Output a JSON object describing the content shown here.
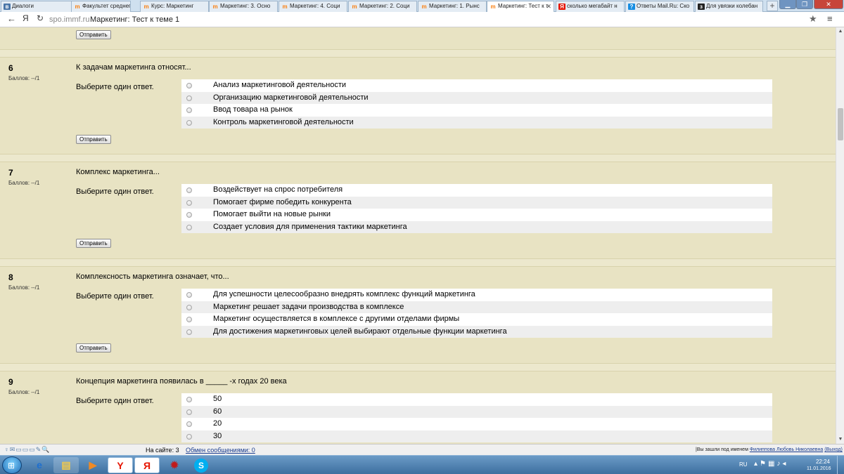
{
  "browser": {
    "tabs": [
      {
        "label": "Диалоги",
        "icon": "vk-icon",
        "color": "#4a76a8"
      },
      {
        "label": "Факультет среднег",
        "icon": "moodle-icon",
        "color": "#f98012"
      },
      {
        "label": "Курс: Маркетинг",
        "icon": "moodle-icon",
        "color": "#f98012"
      },
      {
        "label": "Маркетинг: 3. Осно",
        "icon": "moodle-icon",
        "color": "#f98012"
      },
      {
        "label": "Маркетинг: 4. Соци",
        "icon": "moodle-icon",
        "color": "#f98012"
      },
      {
        "label": "Маркетинг: 2. Соци",
        "icon": "moodle-icon",
        "color": "#f98012"
      },
      {
        "label": "Маркетинг: 1. Рынс",
        "icon": "moodle-icon",
        "color": "#f98012"
      },
      {
        "label": "Маркетинг: Тест к т",
        "icon": "moodle-icon",
        "color": "#f98012",
        "active": true
      },
      {
        "label": "сколько мегабайт н",
        "icon": "yandex-icon",
        "color": "#e61400"
      },
      {
        "label": "Ответы Mail.Ru: Ско",
        "icon": "mailru-answers-icon",
        "color": "#168de2"
      },
      {
        "label": "Для увязки колебан",
        "icon": "znanija-icon",
        "color": "#222222"
      }
    ],
    "url_host": "spo.immf.ru",
    "url_title": "Маркетинг: Тест к теме 1",
    "back_glyph": "←",
    "yandex_glyph": "Я",
    "refresh_glyph": "↻",
    "star_glyph": "★",
    "menu_glyph": "≡"
  },
  "quiz": {
    "submit_label": "Отправить",
    "prompt_label": "Выберите один ответ.",
    "questions": [
      {
        "number": "6",
        "score": "Баллов: --/1",
        "text": "К задачам маркетинга относят...",
        "options": [
          "Анализ маркетинговой деятельности",
          "Организацию маркетинговой деятельности",
          "Ввод товара на рынок",
          "Контроль маркетинговой деятельности"
        ]
      },
      {
        "number": "7",
        "score": "Баллов: --/1",
        "text": "Комплекс маркетинга...",
        "options": [
          "Воздействует на спрос потребителя",
          "Помогает фирме победить конкурента",
          "Помогает выйти на новые рынки",
          "Создает условия для применения тактики маркетинга"
        ]
      },
      {
        "number": "8",
        "score": "Баллов: --/1",
        "text": "Комплексность маркетинга означает, что...",
        "options": [
          "Для успешности целесообразно внедрять комплекс функций маркетинга",
          "Маркетинг решает задачи производства в комплексе",
          "Маркетинг осуществляется в комплексе с другими отделами фирмы",
          "Для достижения маркетинговых целей выбирают отдельные функции маркетинга"
        ]
      },
      {
        "number": "9",
        "score": "Баллов: --/1",
        "text": "Концепция маркетинга появилась в _____ -х годах 20 века",
        "options": [
          "50",
          "60",
          "20",
          "30"
        ]
      }
    ]
  },
  "statusbar": {
    "online": "На сайте: 3",
    "messages": "Обмен сообщениями: 0",
    "user_prefix": "Вы зашли под именем ",
    "user_name": "Филиппова Любовь Николаевна",
    "logout": "(Выход)"
  },
  "taskbar": {
    "lang": "RU",
    "time": "22:24",
    "date": "11.01.2016",
    "apps": [
      "internet-explorer-icon",
      "file-explorer-icon",
      "media-player-icon",
      "yandex-browser-icon",
      "yandex-icon",
      "game-icon",
      "skype-icon"
    ]
  }
}
